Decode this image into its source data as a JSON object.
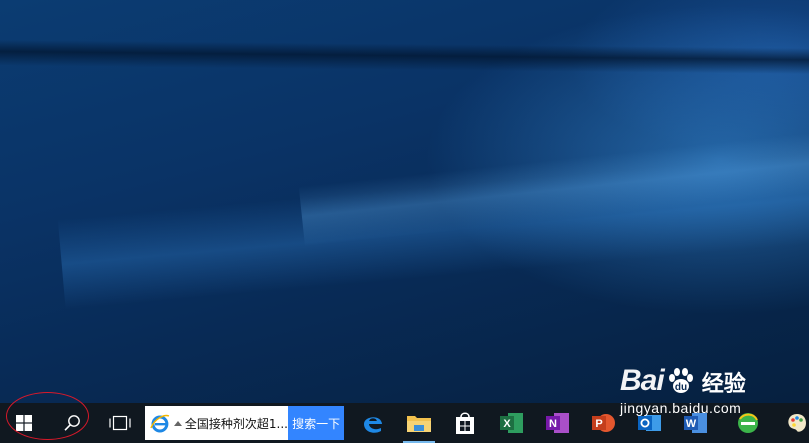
{
  "desktop": {
    "wallpaper": "windows-10-hero-blue",
    "accent_color": "#0b3c72"
  },
  "taskbar": {
    "background": "#101820",
    "start_icon": "windows-logo-icon",
    "search_icon": "magnifier-icon",
    "task_view_icon": "task-view-icon",
    "search_box": {
      "engine_icon": "internet-explorer-icon",
      "query": "全国接种剂次超1...",
      "button_label": "搜索一下",
      "button_color": "#3385ff"
    },
    "pinned_apps": [
      {
        "name": "Microsoft Edge",
        "icon": "edge-icon"
      },
      {
        "name": "File Explorer",
        "icon": "folder-icon"
      },
      {
        "name": "Store",
        "icon": "store-bag-icon"
      },
      {
        "name": "Excel",
        "icon": "excel-icon"
      },
      {
        "name": "OneNote",
        "icon": "onenote-icon"
      },
      {
        "name": "PowerPoint",
        "icon": "powerpoint-icon"
      },
      {
        "name": "Outlook",
        "icon": "outlook-icon"
      },
      {
        "name": "Word",
        "icon": "word-icon"
      },
      {
        "name": "360 Browser",
        "icon": "browser-360-icon"
      },
      {
        "name": "Paint",
        "icon": "paint-icon"
      }
    ]
  },
  "annotation": {
    "color": "#d8192a",
    "target": "start-and-search-buttons"
  },
  "watermark": {
    "brand": "Bai",
    "brand_suffix": "经验",
    "url": "jingyan.baidu.com"
  }
}
